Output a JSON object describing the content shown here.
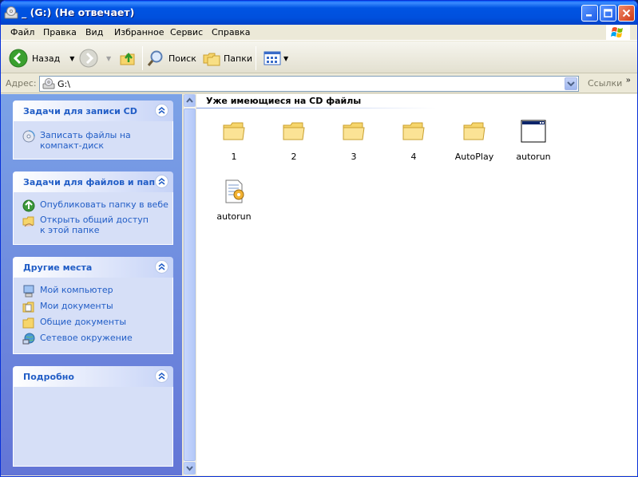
{
  "window": {
    "title": "_ (G:) (Не отвечает)"
  },
  "menu": [
    "Файл",
    "Правка",
    "Вид",
    "Избранное",
    "Сервис",
    "Справка"
  ],
  "toolbar": {
    "back_label": "Назад",
    "search_label": "Поиск",
    "folders_label": "Папки"
  },
  "address": {
    "label": "Адрес:",
    "value": "G:\\",
    "links_label": "Ссылки"
  },
  "sidebar": {
    "panels": [
      {
        "title": "Задачи для записи CD",
        "tasks": [
          {
            "label": "Записать файлы на компакт-диск",
            "icon": "burn-cd-icon"
          }
        ]
      },
      {
        "title": "Задачи для файлов и папок",
        "tasks": [
          {
            "label": "Опубликовать папку в вебе",
            "icon": "publish-web-icon"
          },
          {
            "label": "Открыть общий доступ к этой папке",
            "icon": "share-folder-icon"
          }
        ]
      },
      {
        "title": "Другие места",
        "tasks": [
          {
            "label": "Мой компьютер",
            "icon": "my-computer-icon"
          },
          {
            "label": "Мои документы",
            "icon": "my-documents-icon"
          },
          {
            "label": "Общие документы",
            "icon": "shared-documents-icon"
          },
          {
            "label": "Сетевое окружение",
            "icon": "network-icon"
          }
        ]
      },
      {
        "title": "Подробно",
        "tasks": []
      }
    ]
  },
  "content": {
    "group_title": "Уже имеющиеся на CD файлы",
    "files": [
      {
        "name": "1",
        "icon": "folder-icon"
      },
      {
        "name": "2",
        "icon": "folder-icon"
      },
      {
        "name": "3",
        "icon": "folder-icon"
      },
      {
        "name": "4",
        "icon": "folder-icon"
      },
      {
        "name": "AutoPlay",
        "icon": "folder-icon"
      },
      {
        "name": "autorun",
        "icon": "application-icon"
      },
      {
        "name": "autorun",
        "icon": "setup-info-icon"
      }
    ]
  },
  "colors": {
    "titlebar": "#0054e3",
    "sidebar": "#6f8ee0",
    "task_link": "#215dc6",
    "panel_body": "#d6dff7"
  }
}
